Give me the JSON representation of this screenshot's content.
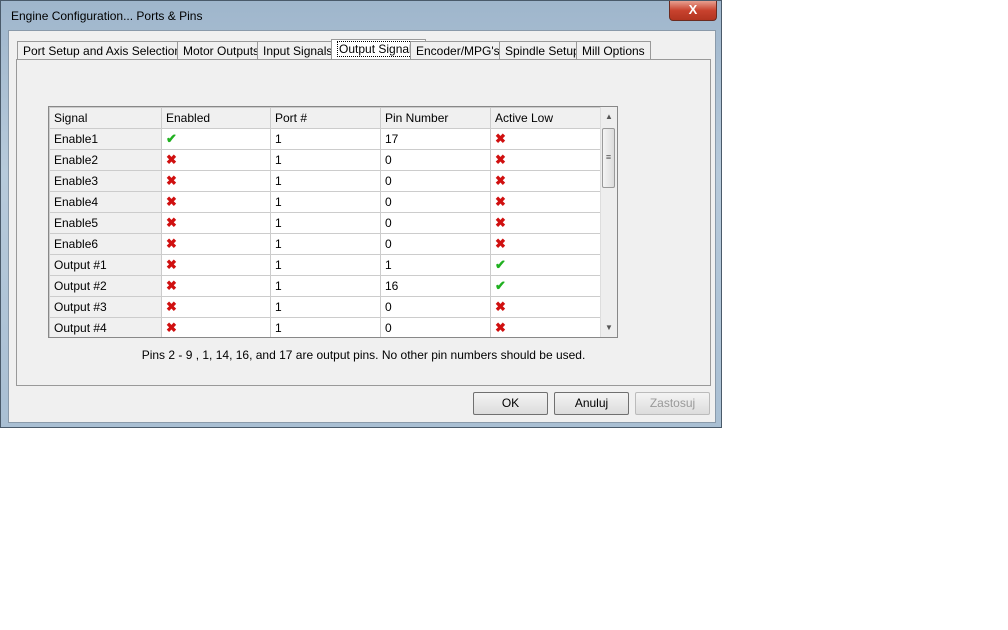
{
  "window": {
    "title": "Engine Configuration... Ports & Pins",
    "close_label": "X"
  },
  "tabs": [
    {
      "label": "Port Setup and Axis Selection"
    },
    {
      "label": "Motor Outputs"
    },
    {
      "label": "Input Signals"
    },
    {
      "label": "Output Signals",
      "active": true
    },
    {
      "label": "Encoder/MPG's"
    },
    {
      "label": "Spindle Setup"
    },
    {
      "label": "Mill Options"
    }
  ],
  "table": {
    "columns": [
      "Signal",
      "Enabled",
      "Port #",
      "Pin Number",
      "Active Low"
    ],
    "rows": [
      {
        "signal": "Enable1",
        "enabled": true,
        "port": "1",
        "pin": "17",
        "active_low": false
      },
      {
        "signal": "Enable2",
        "enabled": false,
        "port": "1",
        "pin": "0",
        "active_low": false
      },
      {
        "signal": "Enable3",
        "enabled": false,
        "port": "1",
        "pin": "0",
        "active_low": false
      },
      {
        "signal": "Enable4",
        "enabled": false,
        "port": "1",
        "pin": "0",
        "active_low": false
      },
      {
        "signal": "Enable5",
        "enabled": false,
        "port": "1",
        "pin": "0",
        "active_low": false
      },
      {
        "signal": "Enable6",
        "enabled": false,
        "port": "1",
        "pin": "0",
        "active_low": false
      },
      {
        "signal": "Output #1",
        "enabled": false,
        "port": "1",
        "pin": "1",
        "active_low": true
      },
      {
        "signal": "Output #2",
        "enabled": false,
        "port": "1",
        "pin": "16",
        "active_low": true
      },
      {
        "signal": "Output #3",
        "enabled": false,
        "port": "1",
        "pin": "0",
        "active_low": false
      },
      {
        "signal": "Output #4",
        "enabled": false,
        "port": "1",
        "pin": "0",
        "active_low": false
      }
    ]
  },
  "note": "Pins 2 - 9 , 1, 14, 16, and 17 are output pins. No  other pin numbers should be used.",
  "buttons": {
    "ok": "OK",
    "cancel": "Anuluj",
    "apply": "Zastosuj"
  },
  "icons": {
    "true": "green-check-icon",
    "false": "red-x-icon"
  }
}
